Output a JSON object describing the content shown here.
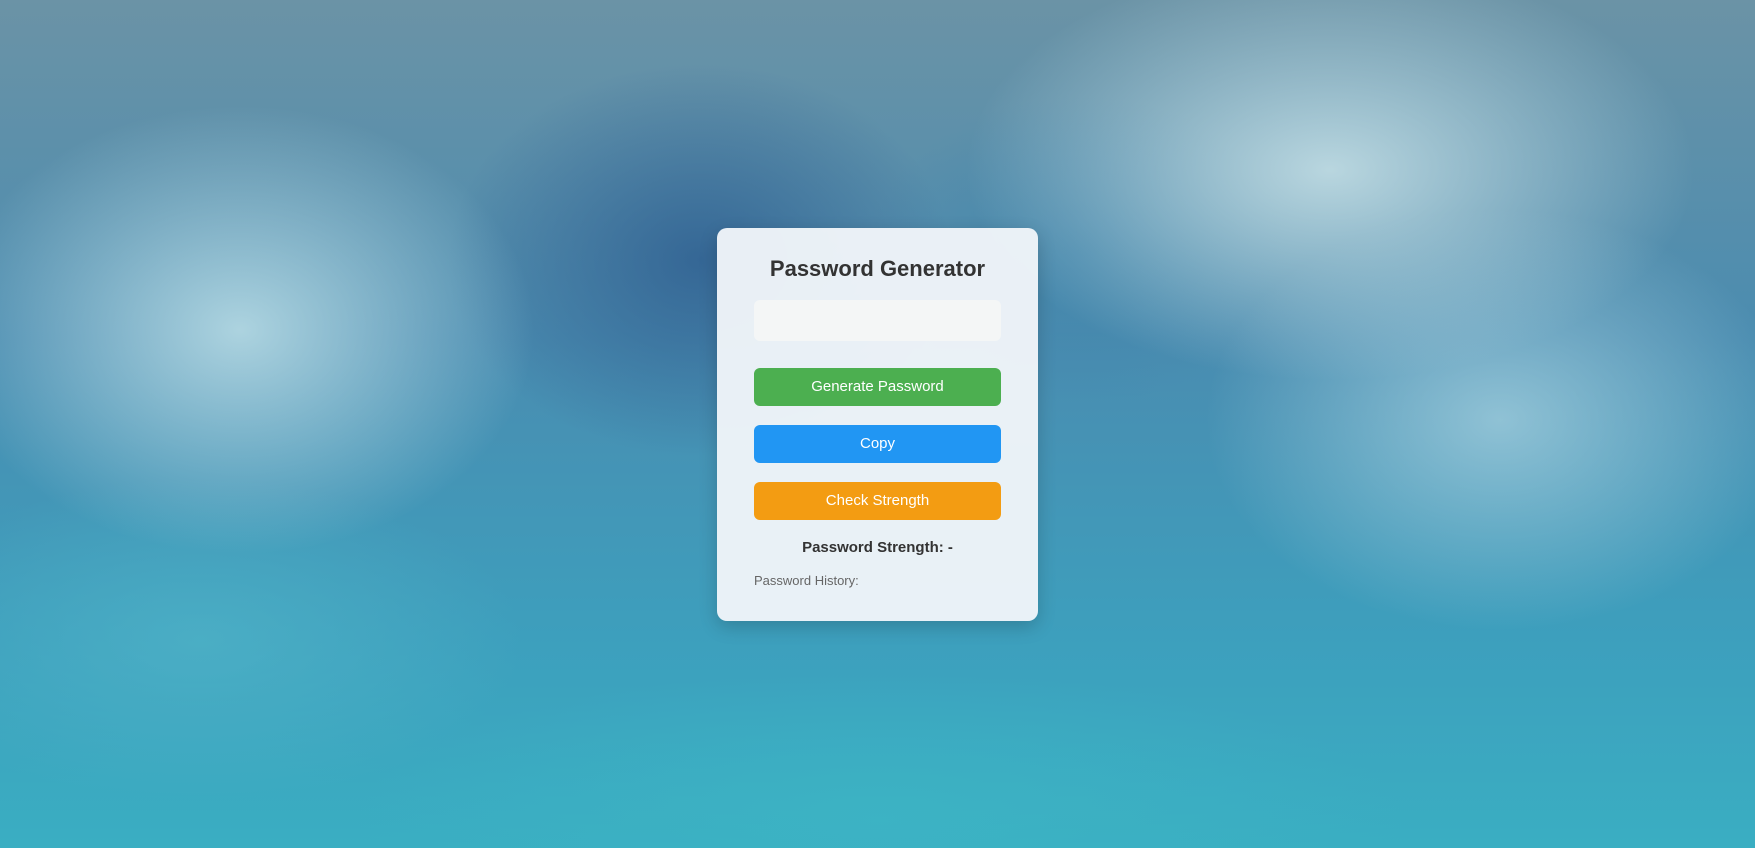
{
  "app": {
    "title": "Password Generator"
  },
  "password_field": {
    "value": "",
    "placeholder": ""
  },
  "buttons": {
    "generate_label": "Generate Password",
    "copy_label": "Copy",
    "check_label": "Check Strength"
  },
  "strength": {
    "text": "Password Strength: -"
  },
  "history": {
    "label": "Password History:",
    "items": []
  },
  "colors": {
    "generate_button": "#4caf50",
    "copy_button": "#2196f3",
    "check_button": "#f39c12",
    "card_background": "#f0f5f9",
    "title_text": "#333333"
  }
}
